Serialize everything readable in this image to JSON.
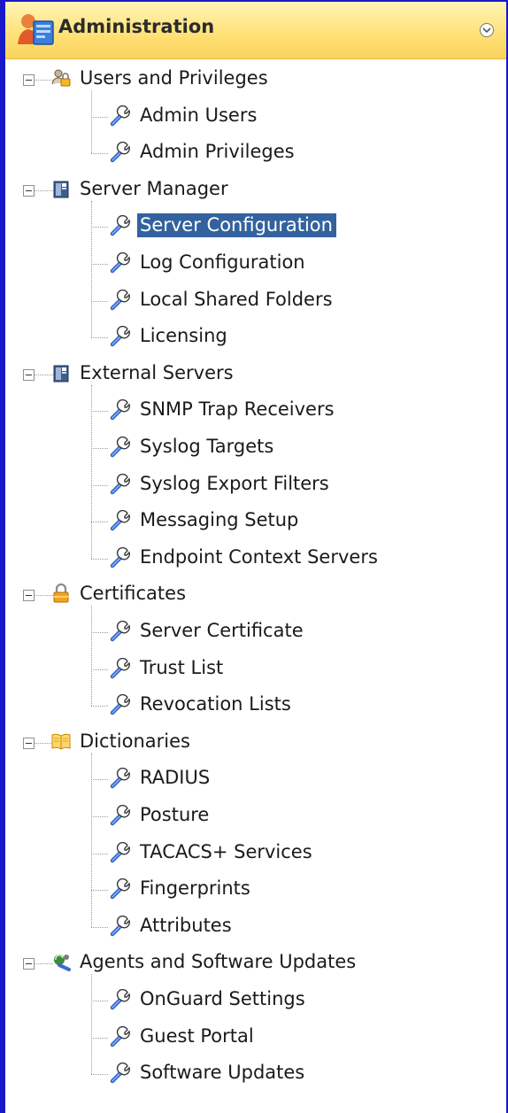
{
  "panel": {
    "title": "Administration",
    "accent_color": "#1818c8",
    "header_icon": "admin-user-icon",
    "selected_bg": "#33629e"
  },
  "categories": [
    {
      "label": "Users and Privileges",
      "icon": "users-lock-icon",
      "items": [
        {
          "label": "Admin Users",
          "icon": "wrench-icon"
        },
        {
          "label": "Admin Privileges",
          "icon": "wrench-icon"
        }
      ]
    },
    {
      "label": "Server Manager",
      "icon": "server-icon",
      "items": [
        {
          "label": "Server Configuration",
          "icon": "wrench-icon",
          "selected": true
        },
        {
          "label": "Log Configuration",
          "icon": "wrench-icon"
        },
        {
          "label": "Local Shared Folders",
          "icon": "wrench-icon"
        },
        {
          "label": "Licensing",
          "icon": "wrench-icon"
        }
      ]
    },
    {
      "label": "External Servers",
      "icon": "server-icon",
      "items": [
        {
          "label": "SNMP Trap Receivers",
          "icon": "wrench-icon"
        },
        {
          "label": "Syslog Targets",
          "icon": "wrench-icon"
        },
        {
          "label": "Syslog Export Filters",
          "icon": "wrench-icon"
        },
        {
          "label": "Messaging Setup",
          "icon": "wrench-icon"
        },
        {
          "label": "Endpoint Context Servers",
          "icon": "wrench-icon"
        }
      ]
    },
    {
      "label": "Certificates",
      "icon": "padlock-icon",
      "items": [
        {
          "label": "Server Certificate",
          "icon": "wrench-icon"
        },
        {
          "label": "Trust List",
          "icon": "wrench-icon"
        },
        {
          "label": "Revocation Lists",
          "icon": "wrench-icon"
        }
      ]
    },
    {
      "label": "Dictionaries",
      "icon": "book-icon",
      "items": [
        {
          "label": "RADIUS",
          "icon": "wrench-icon"
        },
        {
          "label": "Posture",
          "icon": "wrench-icon"
        },
        {
          "label": "TACACS+ Services",
          "icon": "wrench-icon"
        },
        {
          "label": "Fingerprints",
          "icon": "wrench-icon"
        },
        {
          "label": "Attributes",
          "icon": "wrench-icon"
        }
      ]
    },
    {
      "label": "Agents and Software Updates",
      "icon": "software-update-icon",
      "items": [
        {
          "label": "OnGuard Settings",
          "icon": "wrench-icon"
        },
        {
          "label": "Guest Portal",
          "icon": "wrench-icon"
        },
        {
          "label": "Software Updates",
          "icon": "wrench-icon"
        }
      ]
    }
  ]
}
